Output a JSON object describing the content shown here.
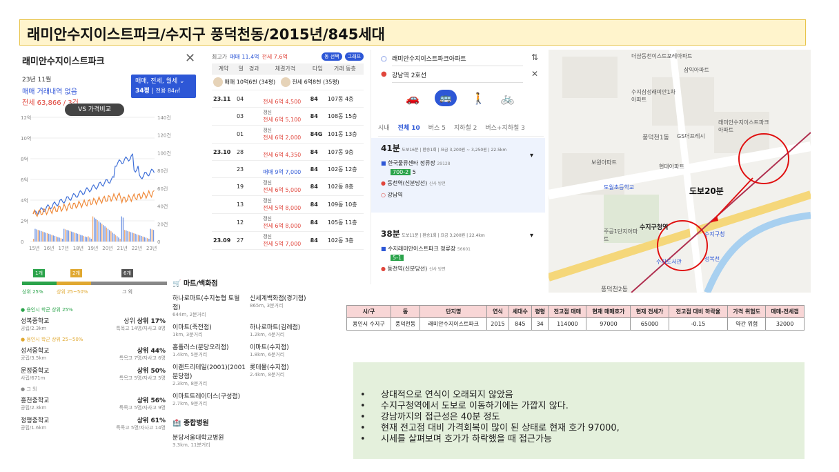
{
  "header": {
    "title": "래미안수지이스트파크/수지구 풍덕천동/2015년/845세대"
  },
  "panel1": {
    "title": "래미안수지이스트파크",
    "date": "23년 11월",
    "no_deal": "매매 거래내역 없음",
    "jeonse": "전세 63,866 / 3건",
    "filter_line1": "매매, 전세, 월세",
    "filter_line2": "34평",
    "filter_line3": "전용 84㎡",
    "vs_button": "VS 가격비교",
    "y_left": [
      "12억",
      "10억",
      "8억",
      "6억",
      "4억",
      "2억",
      "0"
    ],
    "y_right": [
      "140건",
      "120건",
      "100건",
      "80건",
      "60건",
      "40건",
      "20건",
      "0"
    ],
    "x_ticks": [
      "15년",
      "16년",
      "17년",
      "18년",
      "19년",
      "20년",
      "21년",
      "22년",
      "23년"
    ],
    "rank_markers": [
      "1개",
      "2개",
      "6개"
    ],
    "rank_labels": [
      "상위 25%",
      "상위 25~50%",
      "그 외"
    ]
  },
  "schools": [
    {
      "group": "용인시 학군 상위 25%",
      "items": [
        {
          "name": "성복중학교",
          "rank": "상위 17%",
          "dist": "공립/2.3km",
          "extra": "특목고 14명/자사고 8명"
        }
      ]
    },
    {
      "group": "용인시 학군 상위 25~50%",
      "items": [
        {
          "name": "성서중학교",
          "rank": "상위 44%",
          "dist": "공립/3.5km",
          "extra": "특목고 7명/자사고 6명"
        },
        {
          "name": "문정중학교",
          "rank": "상위 50%",
          "dist": "사립/671m",
          "extra": "특목고 5명/자사고 5명"
        }
      ]
    },
    {
      "group": "그 외",
      "items": [
        {
          "name": "홍천중학교",
          "rank": "상위 56%",
          "dist": "공립/2.3km",
          "extra": "특목고 5명/자사고 9명"
        },
        {
          "name": "정평중학교",
          "rank": "상위 61%",
          "dist": "공립/1.6km",
          "extra": "특목고 5명/자사고 14명"
        }
      ]
    }
  ],
  "panel2": {
    "top_label": "최고가",
    "top_sale": "매매 11.4억",
    "top_jeonse": "전세 7.6억",
    "btn_dong": "동 선택",
    "btn_graph": "그래프",
    "headers": [
      "계약",
      "일",
      "경과",
      "체결가격",
      "타입",
      "거래 동층"
    ],
    "agent1": "매매 10억6천 (34평)",
    "agent2": "전세 6억8천 (35평)",
    "rows": [
      {
        "month": "23.11",
        "day": "04",
        "tag": "",
        "price": "전세 6억 4,500",
        "kind": "jeonse",
        "type": "84",
        "dong": "107동 4층"
      },
      {
        "month": "",
        "day": "03",
        "tag": "갱신",
        "price": "전세 6억 5,100",
        "kind": "jeonse",
        "type": "84",
        "dong": "108동 15층"
      },
      {
        "month": "",
        "day": "01",
        "tag": "갱신",
        "price": "전세 6억 2,000",
        "kind": "jeonse",
        "type": "84G",
        "dong": "101동 13층"
      },
      {
        "month": "23.10",
        "day": "28",
        "tag": "",
        "price": "전세 6억 4,350",
        "kind": "jeonse",
        "type": "84",
        "dong": "107동 9층"
      },
      {
        "month": "",
        "day": "23",
        "tag": "",
        "price": "매매 9억 7,000",
        "kind": "sale",
        "type": "84",
        "dong": "102동 12층"
      },
      {
        "month": "",
        "day": "19",
        "tag": "갱신",
        "price": "전세 6억 5,000",
        "kind": "jeonse",
        "type": "84",
        "dong": "102동 8층"
      },
      {
        "month": "",
        "day": "13",
        "tag": "갱신",
        "price": "전세 5억 8,000",
        "kind": "jeonse",
        "type": "84",
        "dong": "109동 10층"
      },
      {
        "month": "",
        "day": "12",
        "tag": "갱신",
        "price": "전세 6억 8,000",
        "kind": "jeonse",
        "type": "84",
        "dong": "105동 11층"
      },
      {
        "month": "23.09",
        "day": "27",
        "tag": "갱신",
        "price": "전세 5억 7,000",
        "kind": "jeonse",
        "type": "84",
        "dong": "102동 3층"
      }
    ]
  },
  "panel3": {
    "origin": "래미안수지이스트파크아파트",
    "destination": "강남역 2호선",
    "tabs": [
      "시내",
      "전체 10",
      "버스 5",
      "지하철 2",
      "버스+지하철 3"
    ],
    "route1": {
      "time": "41분",
      "detail": "도보16분 | 환승1회 | 요금 3,200원 ~ 3,250원 | 22.5km",
      "stop1": "한국물류센타 정류장",
      "stop1_no": "29128",
      "bus1": "700-2",
      "bus2": "5",
      "stop2": "동천역(신분당선)",
      "stop2_note": "신사 방면",
      "end": "강남역"
    },
    "route2": {
      "time": "38분",
      "detail": "도보11분 | 환승1회 | 요금 3,200원 | 22.4km",
      "stop1": "수지래미안이스트파크 정류장",
      "stop1_no": "56601",
      "bus1": "5-1",
      "stop2": "동천역(신분당선)",
      "stop2_note": "신사 방면"
    }
  },
  "map": {
    "labels": [
      "더샵동천이스트포레아파트",
      "삼익아파트",
      "수지삼성래미안1차아파트",
      "래미안수지이스트파크아파트",
      "풍덕천1동 ",
      "GS더프레시",
      "보원아파트",
      "현대아파트",
      "토월초등학교",
      "수지구청역",
      "주공1단지아파트",
      "수지구청",
      "수지도서관",
      "성복천",
      "풍덕천2동"
    ],
    "walk_label": "도보20분"
  },
  "marts": {
    "title": "마트/백화점",
    "items": [
      {
        "name": "하나로마트(수지농협 토월점)",
        "dist": "644m, 2분거리"
      },
      {
        "name": "신세계백화점(경기점)",
        "dist": "865m, 3분거리"
      },
      {
        "name": "이마트(죽전점)",
        "dist": "1km, 3분거리"
      },
      {
        "name": "하나로마트(김례점)",
        "dist": "1.2km, 4분거리"
      },
      {
        "name": "홈플러스(분당오리점)",
        "dist": "1.4km, 5분거리"
      },
      {
        "name": "이마트(수지점)",
        "dist": "1.8km, 6분거리"
      },
      {
        "name": "이랜드리테일(2001)(2001 분당점)",
        "dist": "2.3km, 8분거리"
      },
      {
        "name": "롯데몰(수지점)",
        "dist": "2.4km, 8분거리"
      },
      {
        "name": "이마트트레이더스(구성점)",
        "dist": "2.7km, 9분거리"
      }
    ],
    "hospital_title": "종합병원",
    "hospital_name": "분당서울대학교병원",
    "hospital_dist": "3.3km, 11분거리"
  },
  "summary": {
    "headers": [
      "시/구",
      "동",
      "단지명",
      "연식",
      "세대수",
      "평형",
      "전고점 매매",
      "현재 매매호가",
      "현재 전세가",
      "전고점 대비 하락율",
      "가격 위험도",
      "매매-전세갭"
    ],
    "row": [
      "용인시 수지구",
      "풍덕천동",
      "래미안수지이스트파크",
      "2015",
      "845",
      "34",
      "114000",
      "97000",
      "65000",
      "-0.15",
      "약간 위험",
      "32000"
    ]
  },
  "notes": [
    "상대적으로 연식이 오래되지 않았음",
    "수지구청역에서 도보로 이동하기에는 가깝지 않다.",
    "강남까지의 접근성은 40분 정도",
    "현재 전고점 대비 가격회복이 많이 된 상태로 현재 호가 97000,",
    "시세를 살펴보며 호가가 하락했을 때 접근가능"
  ],
  "colors": {
    "accent_blue": "#2d57d6",
    "accent_red": "#e0463c",
    "title_bg": "#fff4cc",
    "notes_bg": "#e4f0dc"
  }
}
